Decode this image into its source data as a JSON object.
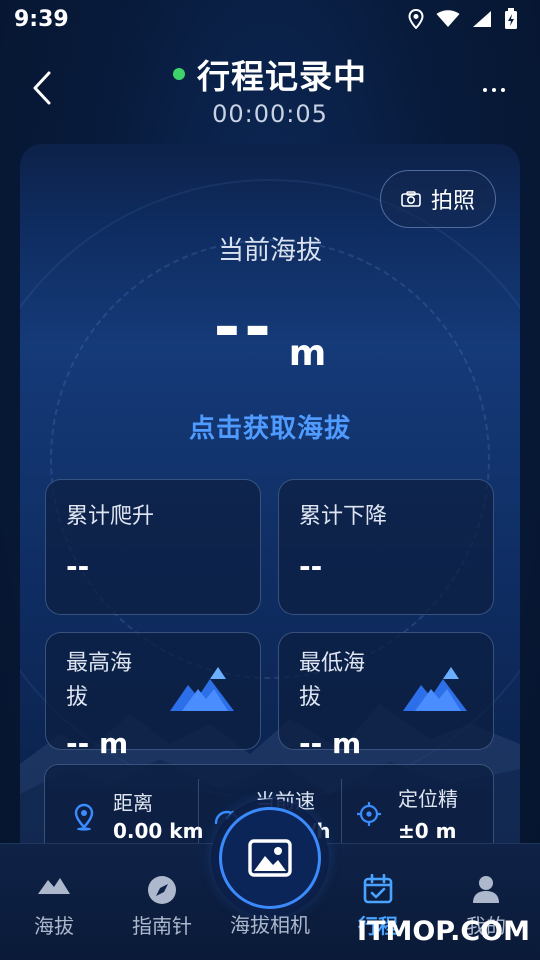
{
  "status_bar": {
    "time": "9:39"
  },
  "header": {
    "title": "行程记录中",
    "timer": "00:00:05"
  },
  "photo_button": {
    "label": "拍照"
  },
  "altitude": {
    "label": "当前海拔",
    "value": "--",
    "unit": "m",
    "action_label": "点击获取海拔"
  },
  "stats": {
    "climb": {
      "title": "累计爬升",
      "value": "--"
    },
    "descent": {
      "title": "累计下降",
      "value": "--"
    },
    "highest": {
      "title_line1": "最高海",
      "title_line2": "拔",
      "value": "-- m"
    },
    "lowest": {
      "title_line1": "最低海",
      "title_line2": "拔",
      "value": "-- m"
    }
  },
  "info_strip": {
    "distance": {
      "label": "距离",
      "value": "0.00 km"
    },
    "speed": {
      "label": "当前速",
      "value": "/h"
    },
    "accuracy": {
      "label": "定位精",
      "value": "±0 m"
    }
  },
  "bottom_nav": {
    "items": [
      {
        "label": "海拔",
        "icon": "mountain-icon"
      },
      {
        "label": "指南针",
        "icon": "compass-icon"
      },
      {
        "label": "海拔相机",
        "icon": "image-icon"
      },
      {
        "label": "行程",
        "icon": "calendar-check-icon"
      },
      {
        "label": "我的",
        "icon": "person-icon"
      }
    ],
    "active_index": 3
  },
  "watermark": "ITMOP.COM",
  "colors": {
    "accent": "#4f9bff",
    "recording_dot": "#3fd46b",
    "background": "#081b3c"
  }
}
